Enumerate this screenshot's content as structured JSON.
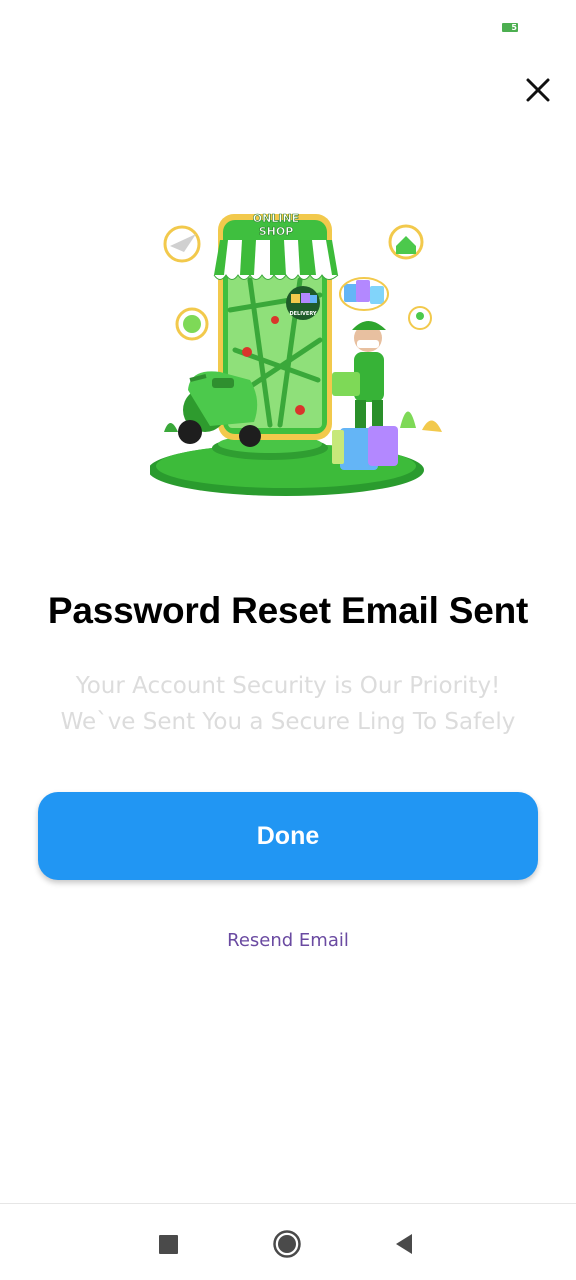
{
  "status_bar": {
    "battery_level": "5"
  },
  "header": {
    "close_icon": "close-icon"
  },
  "illustration": {
    "sign_text": "ONLINE SHOP",
    "badge_text": "DELIVERY",
    "description_icon": "online-shop-delivery-illustration"
  },
  "content": {
    "title": "Password Reset Email Sent",
    "subtitle_line1": "Your Account Security is Our Priority!",
    "subtitle_line2": "We`ve Sent You a Secure Ling To Safely"
  },
  "actions": {
    "done_label": "Done",
    "resend_label": "Resend Email"
  },
  "nav_bar": {
    "recent_icon": "square-icon",
    "home_icon": "circle-icon",
    "back_icon": "triangle-back-icon"
  },
  "colors": {
    "primary": "#2196f3",
    "link": "#6a4aa1",
    "subtitle": "#dcdcdc",
    "illustration_green": "#3dbb3a"
  }
}
